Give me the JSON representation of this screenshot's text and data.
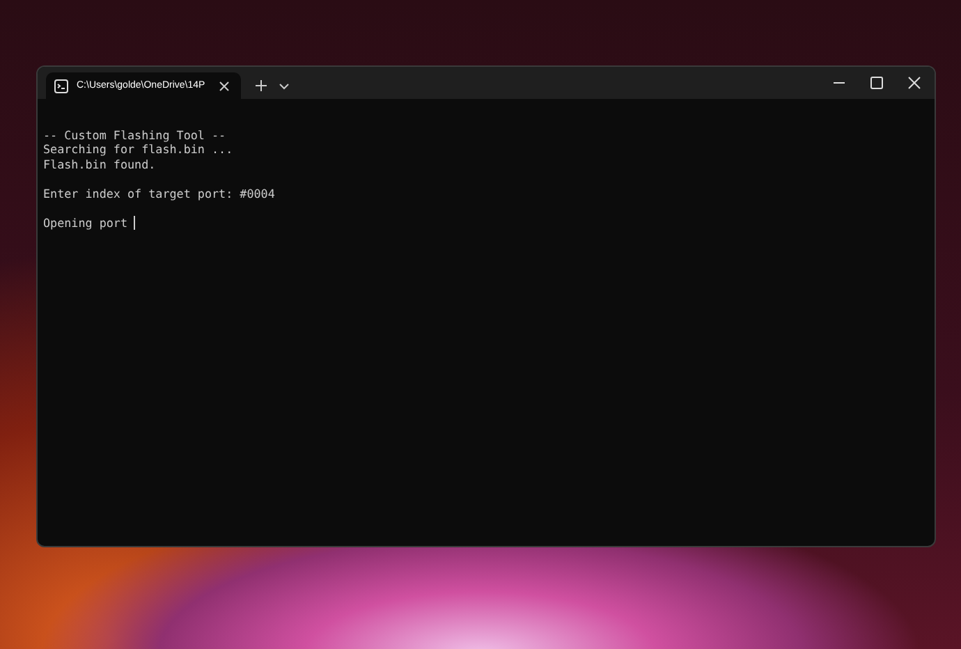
{
  "window": {
    "tabs": [
      {
        "title": "C:\\Users\\golde\\OneDrive\\14P",
        "selected": true
      }
    ]
  },
  "terminal": {
    "blocks": [
      [
        "-- Custom Flashing Tool --",
        "Searching for flash.bin ...",
        "Flash.bin found."
      ],
      [
        "Enter index of target port: #0004"
      ],
      [
        "Opening port"
      ]
    ]
  }
}
